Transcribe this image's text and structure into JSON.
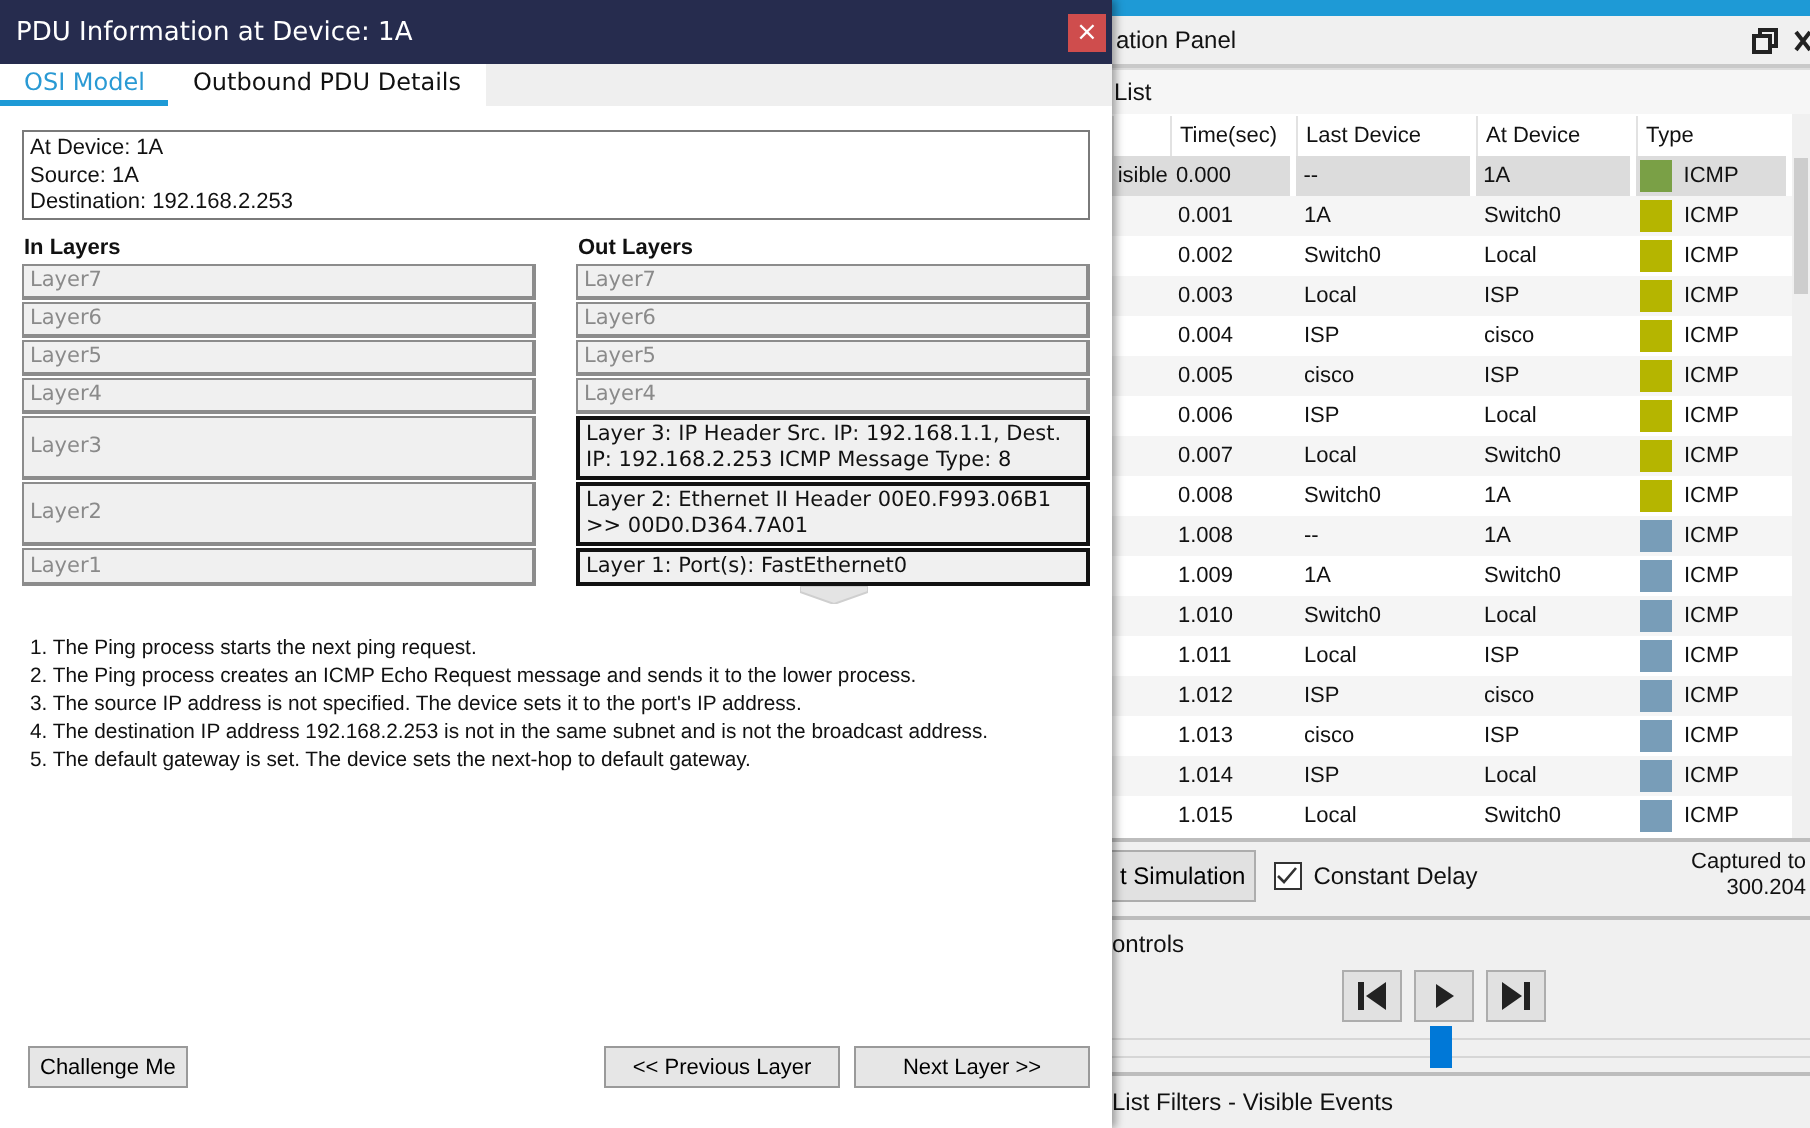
{
  "dialog": {
    "title": "PDU Information at Device: 1A",
    "close": "×",
    "tabs": [
      {
        "label": "OSI Model",
        "selected": true
      },
      {
        "label": "Outbound PDU Details",
        "selected": false
      }
    ],
    "info": [
      "At Device: 1A",
      "Source: 1A",
      "Destination: 192.168.2.253"
    ],
    "in_layers": {
      "heading": "In Layers",
      "layers": [
        {
          "label": "Layer7",
          "active": false
        },
        {
          "label": "Layer6",
          "active": false
        },
        {
          "label": "Layer5",
          "active": false
        },
        {
          "label": "Layer4",
          "active": false
        },
        {
          "label": "Layer3",
          "active": false
        },
        {
          "label": "Layer2",
          "active": false
        },
        {
          "label": "Layer1",
          "active": false
        }
      ]
    },
    "out_layers": {
      "heading": "Out Layers",
      "layers": [
        {
          "label": "Layer7",
          "active": false
        },
        {
          "label": "Layer6",
          "active": false
        },
        {
          "label": "Layer5",
          "active": false
        },
        {
          "label": "Layer4",
          "active": false
        },
        {
          "label": "Layer 3: IP Header Src. IP: 192.168.1.1, Dest. IP: 192.168.2.253 ICMP Message Type: 8",
          "active": true
        },
        {
          "label": "Layer 2: Ethernet II Header 00E0.F993.06B1 >> 00D0.D364.7A01",
          "active": true
        },
        {
          "label": "Layer 1: Port(s): FastEthernet0",
          "active": true
        }
      ]
    },
    "steps": [
      "1. The Ping process starts the next ping request.",
      "2. The Ping process creates an ICMP Echo Request message and sends it to the lower process.",
      "3. The source IP address is not specified. The device sets it to the port's IP address.",
      "4. The destination IP address 192.168.2.253 is not in the same subnet and is not the broadcast address.",
      "5. The default gateway is set. The device sets the next-hop to default gateway."
    ],
    "buttons": {
      "challenge": "Challenge Me",
      "previous": "<< Previous Layer",
      "next": "Next Layer >>"
    }
  },
  "panel": {
    "title": "ation Panel",
    "list_label": "List",
    "table": {
      "columns": [
        "Time(sec)",
        "Last Device",
        "At Device",
        "Type"
      ],
      "rows": [
        {
          "column_1": "isible",
          "time": "0.000",
          "last_device": "--",
          "at_device": "1A",
          "type": "ICMP",
          "color": "#7aa046",
          "selected": true
        },
        {
          "time": "0.001",
          "last_device": "1A",
          "at_device": "Switch0",
          "type": "ICMP",
          "color": "#b5b500",
          "selected": false
        },
        {
          "time": "0.002",
          "last_device": "Switch0",
          "at_device": "Local",
          "type": "ICMP",
          "color": "#b5b500",
          "selected": false
        },
        {
          "time": "0.003",
          "last_device": "Local",
          "at_device": "ISP",
          "type": "ICMP",
          "color": "#b5b500",
          "selected": false
        },
        {
          "time": "0.004",
          "last_device": "ISP",
          "at_device": "cisco",
          "type": "ICMP",
          "color": "#b5b500",
          "selected": false
        },
        {
          "time": "0.005",
          "last_device": "cisco",
          "at_device": "ISP",
          "type": "ICMP",
          "color": "#b5b500",
          "selected": false
        },
        {
          "time": "0.006",
          "last_device": "ISP",
          "at_device": "Local",
          "type": "ICMP",
          "color": "#b5b500",
          "selected": false
        },
        {
          "time": "0.007",
          "last_device": "Local",
          "at_device": "Switch0",
          "type": "ICMP",
          "color": "#b5b500",
          "selected": false
        },
        {
          "time": "0.008",
          "last_device": "Switch0",
          "at_device": "1A",
          "type": "ICMP",
          "color": "#b5b500",
          "selected": false
        },
        {
          "time": "1.008",
          "last_device": "--",
          "at_device": "1A",
          "type": "ICMP",
          "color": "#789db8",
          "selected": false
        },
        {
          "time": "1.009",
          "last_device": "1A",
          "at_device": "Switch0",
          "type": "ICMP",
          "color": "#789db8",
          "selected": false
        },
        {
          "time": "1.010",
          "last_device": "Switch0",
          "at_device": "Local",
          "type": "ICMP",
          "color": "#789db8",
          "selected": false
        },
        {
          "time": "1.011",
          "last_device": "Local",
          "at_device": "ISP",
          "type": "ICMP",
          "color": "#789db8",
          "selected": false
        },
        {
          "time": "1.012",
          "last_device": "ISP",
          "at_device": "cisco",
          "type": "ICMP",
          "color": "#789db8",
          "selected": false
        },
        {
          "time": "1.013",
          "last_device": "cisco",
          "at_device": "ISP",
          "type": "ICMP",
          "color": "#789db8",
          "selected": false
        },
        {
          "time": "1.014",
          "last_device": "ISP",
          "at_device": "Local",
          "type": "ICMP",
          "color": "#789db8",
          "selected": false
        },
        {
          "time": "1.015",
          "last_device": "Local",
          "at_device": "Switch0",
          "type": "ICMP",
          "color": "#789db8",
          "selected": false
        }
      ]
    },
    "reset_button": "t Simulation",
    "constant_delay": {
      "label": "Constant Delay",
      "checked": true
    },
    "captured": [
      "Captured to",
      "300.204"
    ],
    "controls_label": "ontrols",
    "slider": {
      "level": 0.47
    },
    "filters_label": "List Filters - Visible Events"
  }
}
